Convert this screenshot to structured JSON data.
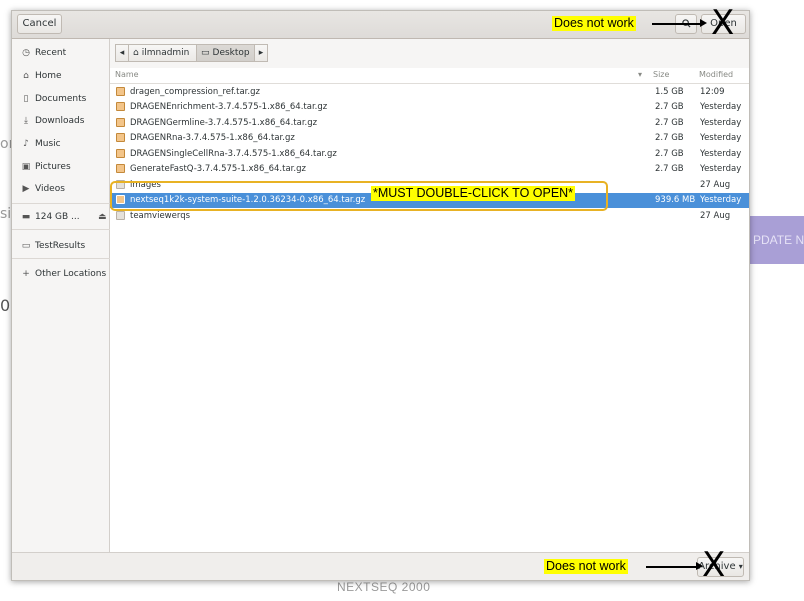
{
  "background": {
    "left_fragments": [
      "or",
      "si",
      "0"
    ],
    "update_button_text": "PDATE N",
    "footer_text": "NEXTSEQ 2000"
  },
  "header": {
    "cancel_label": "Cancel",
    "open_label": "Open"
  },
  "sidebar": {
    "items": [
      {
        "label": "Recent",
        "icon": "clock-icon"
      },
      {
        "label": "Home",
        "icon": "home-icon"
      },
      {
        "label": "Documents",
        "icon": "document-icon"
      },
      {
        "label": "Downloads",
        "icon": "download-icon"
      },
      {
        "label": "Music",
        "icon": "music-icon"
      },
      {
        "label": "Pictures",
        "icon": "picture-icon"
      },
      {
        "label": "Videos",
        "icon": "video-icon"
      },
      {
        "label": "124 GB ...",
        "icon": "drive-icon"
      },
      {
        "label": "TestResults",
        "icon": "folder-icon"
      },
      {
        "label": "Other Locations",
        "icon": "plus-icon"
      }
    ]
  },
  "pathbar": {
    "segments": [
      "ilmnadmin",
      "Desktop"
    ]
  },
  "filelist": {
    "columns": {
      "name": "Name",
      "size": "Size",
      "modified": "Modified"
    },
    "rows": [
      {
        "name": "dragen_compression_ref.tar.gz",
        "size": "1.5 GB",
        "modified": "12:09"
      },
      {
        "name": "DRAGENEnrichment-3.7.4.575-1.x86_64.tar.gz",
        "size": "2.7 GB",
        "modified": "Yesterday"
      },
      {
        "name": "DRAGENGermline-3.7.4.575-1.x86_64.tar.gz",
        "size": "2.7 GB",
        "modified": "Yesterday"
      },
      {
        "name": "DRAGENRna-3.7.4.575-1.x86_64.tar.gz",
        "size": "2.7 GB",
        "modified": "Yesterday"
      },
      {
        "name": "DRAGENSingleCellRna-3.7.4.575-1.x86_64.tar.gz",
        "size": "2.7 GB",
        "modified": "Yesterday"
      },
      {
        "name": "GenerateFastQ-3.7.4.575-1.x86_64.tar.gz",
        "size": "2.7 GB",
        "modified": "Yesterday"
      },
      {
        "name": "images",
        "size": "",
        "modified": "27 Aug"
      },
      {
        "name": "nextseq1k2k-system-suite-1.2.0.36234-0.x86_64.tar.gz",
        "size": "939.6 MB",
        "modified": "Yesterday"
      },
      {
        "name": "teamviewerqs",
        "size": "",
        "modified": "27 Aug"
      }
    ]
  },
  "bottombar": {
    "archive_label": "Archive"
  },
  "annotations": {
    "top_note": "Does not work",
    "bottom_note": "Does not work",
    "double_click_note": "*MUST DOUBLE-CLICK TO OPEN*",
    "x_mark": "X",
    "highlight_color": "#ffff00",
    "box_color": "#e8b224"
  },
  "colors": {
    "selection": "#4a90d9",
    "background_accent": "#a99fd6"
  }
}
